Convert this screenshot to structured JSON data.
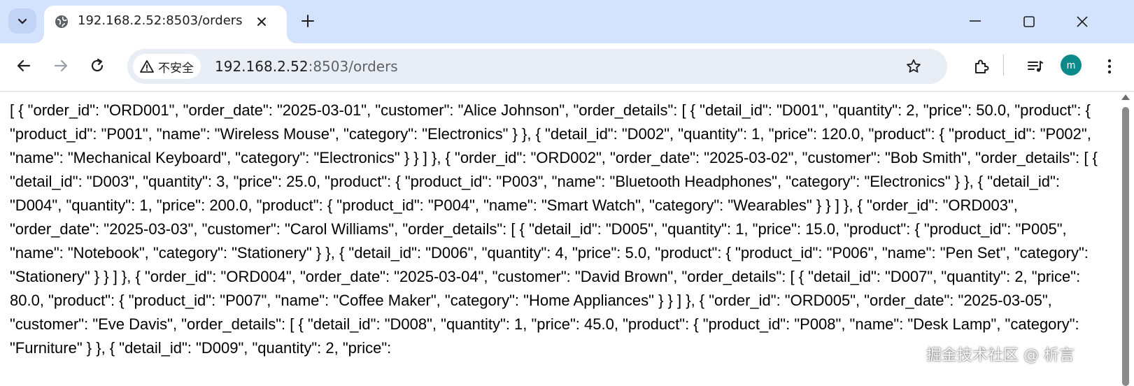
{
  "tab": {
    "title": "192.168.2.52:8503/orders"
  },
  "address_bar": {
    "security_label": "不安全",
    "host": "192.168.2.52",
    "path": ":8503/orders"
  },
  "avatar": {
    "initial": "m",
    "color": "#0b8a8a"
  },
  "page": {
    "body_text": "[ { \"order_id\": \"ORD001\", \"order_date\": \"2025-03-01\", \"customer\": \"Alice Johnson\", \"order_details\": [ { \"detail_id\": \"D001\", \"quantity\": 2, \"price\": 50.0, \"product\": { \"product_id\": \"P001\", \"name\": \"Wireless Mouse\", \"category\": \"Electronics\" } }, { \"detail_id\": \"D002\", \"quantity\": 1, \"price\": 120.0, \"product\": { \"product_id\": \"P002\", \"name\": \"Mechanical Keyboard\", \"category\": \"Electronics\" } } ] }, { \"order_id\": \"ORD002\", \"order_date\": \"2025-03-02\", \"customer\": \"Bob Smith\", \"order_details\": [ { \"detail_id\": \"D003\", \"quantity\": 3, \"price\": 25.0, \"product\": { \"product_id\": \"P003\", \"name\": \"Bluetooth Headphones\", \"category\": \"Electronics\" } }, { \"detail_id\": \"D004\", \"quantity\": 1, \"price\": 200.0, \"product\": { \"product_id\": \"P004\", \"name\": \"Smart Watch\", \"category\": \"Wearables\" } } ] }, { \"order_id\": \"ORD003\", \"order_date\": \"2025-03-03\", \"customer\": \"Carol Williams\", \"order_details\": [ { \"detail_id\": \"D005\", \"quantity\": 1, \"price\": 15.0, \"product\": { \"product_id\": \"P005\", \"name\": \"Notebook\", \"category\": \"Stationery\" } }, { \"detail_id\": \"D006\", \"quantity\": 4, \"price\": 5.0, \"product\": { \"product_id\": \"P006\", \"name\": \"Pen Set\", \"category\": \"Stationery\" } } ] }, { \"order_id\": \"ORD004\", \"order_date\": \"2025-03-04\", \"customer\": \"David Brown\", \"order_details\": [ { \"detail_id\": \"D007\", \"quantity\": 2, \"price\": 80.0, \"product\": { \"product_id\": \"P007\", \"name\": \"Coffee Maker\", \"category\": \"Home Appliances\" } } ] }, { \"order_id\": \"ORD005\", \"order_date\": \"2025-03-05\", \"customer\": \"Eve Davis\", \"order_details\": [ { \"detail_id\": \"D008\", \"quantity\": 1, \"price\": 45.0, \"product\": { \"product_id\": \"P008\", \"name\": \"Desk Lamp\", \"category\": \"Furniture\" } }, { \"detail_id\": \"D009\", \"quantity\": 2, \"price\":"
  },
  "watermark": "掘金技术社区 @ 析言"
}
